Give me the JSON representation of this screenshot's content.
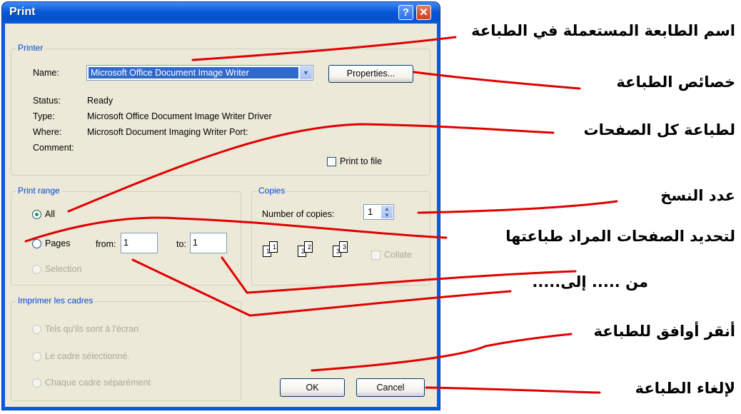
{
  "dialog": {
    "title": "Print",
    "help_label": "?",
    "close_label": "✕"
  },
  "printer": {
    "group_label": "Printer",
    "name_label": "Name:",
    "name_value": "Microsoft Office Document Image Writer",
    "properties_label": "Properties...",
    "status_label": "Status:",
    "status_value": "Ready",
    "type_label": "Type:",
    "type_value": "Microsoft Office Document Image Writer Driver",
    "where_label": "Where:",
    "where_value": "Microsoft Document Imaging Writer Port:",
    "comment_label": "Comment:",
    "print_to_file_label": "Print to file"
  },
  "print_range": {
    "group_label": "Print range",
    "all_label": "All",
    "pages_label": "Pages",
    "from_label": "from:",
    "from_value": "1",
    "to_label": "to:",
    "to_value": "1",
    "selection_label": "Selection"
  },
  "copies": {
    "group_label": "Copies",
    "number_label": "Number of copies:",
    "number_value": "1",
    "collate_label": "Collate",
    "stack_icons": [
      {
        "back": "1",
        "front": "1"
      },
      {
        "back": "2",
        "front": "2"
      },
      {
        "back": "3",
        "front": "3"
      }
    ]
  },
  "frames": {
    "group_label": "Imprimer les cadres",
    "option1": "Tels qu'ils sont à l'écran",
    "option2": "Le cadre sélectionné.",
    "option3": "Chaque cadre séparément"
  },
  "buttons": {
    "ok": "OK",
    "cancel": "Cancel"
  },
  "annotations": {
    "printer_name": "اسم الطابعة المستعملة في الطباعة",
    "properties": "خصائص الطباعة",
    "print_all": "لطباعة كل الصفحات",
    "copies": "عدد النسخ",
    "pages": "لتحديد الصفحات المراد طباعتها",
    "from_to": "من ..... إلى.....",
    "ok": "أنقر أوافق للطباعة",
    "cancel": "لإلغاء الطباعة"
  },
  "colors": {
    "title_bar": "#0a5fd8",
    "dialog_face": "#ece9d8",
    "group_label": "#0046d5",
    "annotation_line": "#e00000"
  }
}
